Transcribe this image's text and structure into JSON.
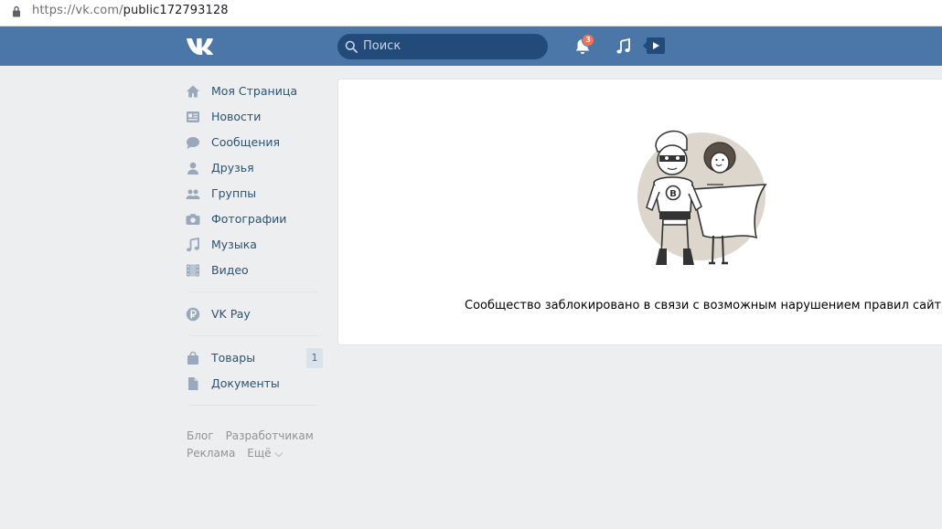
{
  "browser": {
    "url_host": "https://vk.com/",
    "url_path": "public172793128"
  },
  "header": {
    "logo": "vk-logo",
    "search_placeholder": "Поиск",
    "notifications_count": "3"
  },
  "sidebar": {
    "items": [
      {
        "label": "Моя Страница",
        "icon": "home-icon"
      },
      {
        "label": "Новости",
        "icon": "news-icon"
      },
      {
        "label": "Сообщения",
        "icon": "messages-icon"
      },
      {
        "label": "Друзья",
        "icon": "friends-icon"
      },
      {
        "label": "Группы",
        "icon": "groups-icon"
      },
      {
        "label": "Фотографии",
        "icon": "camera-icon"
      },
      {
        "label": "Музыка",
        "icon": "music-note-icon"
      },
      {
        "label": "Видео",
        "icon": "film-icon"
      }
    ],
    "pay": {
      "label": "VK Pay",
      "icon": "ruble-icon"
    },
    "extra": [
      {
        "label": "Товары",
        "icon": "bag-icon",
        "count": "1"
      },
      {
        "label": "Документы",
        "icon": "document-icon"
      }
    ],
    "footer": {
      "blog": "Блог",
      "developers": "Разработчикам",
      "ads": "Реклама",
      "more": "Ещё ⌵"
    }
  },
  "main": {
    "message": "Сообщество заблокировано в связи с возможным нарушением правил сайта."
  },
  "colors": {
    "header_bg": "#4a76a8",
    "page_bg": "#edeef0",
    "link": "#285473",
    "icon": "#99a9bc",
    "badge": "#ff734c"
  }
}
